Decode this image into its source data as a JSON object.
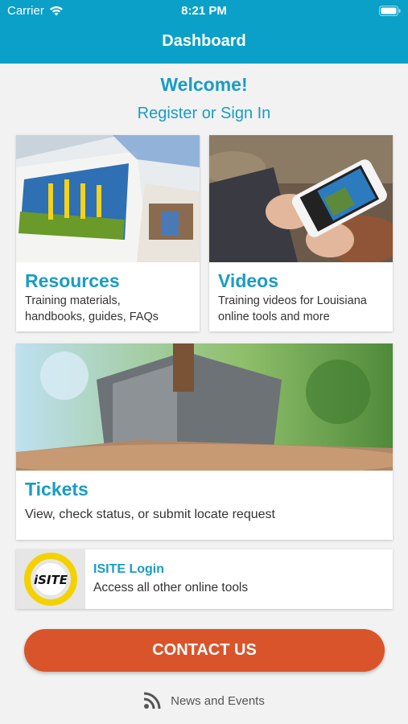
{
  "status_bar": {
    "carrier": "Carrier",
    "time": "8:21 PM"
  },
  "header": {
    "title": "Dashboard"
  },
  "welcome": {
    "heading": "Welcome!",
    "signin_link": "Register or Sign In"
  },
  "cards": {
    "resources": {
      "title": "Resources",
      "desc_line1": "Training materials,",
      "desc_line2": "handbooks, guides, FAQs"
    },
    "videos": {
      "title": "Videos",
      "desc_line1": "Training videos for Louisiana",
      "desc_line2": "online tools and more"
    },
    "tickets": {
      "title": "Tickets",
      "desc": "View, check status, or submit locate request"
    }
  },
  "isite": {
    "title": "ISITE Login",
    "desc": "Access all other online tools",
    "logo_text": "iSITE"
  },
  "contact_button": "CONTACT US",
  "news_link": "News and Events",
  "colors": {
    "header": "#0aa0c8",
    "accent": "#1a9cc4",
    "contact": "#d9542a"
  },
  "icons": [
    "wifi-icon",
    "battery-icon",
    "rss-icon"
  ]
}
